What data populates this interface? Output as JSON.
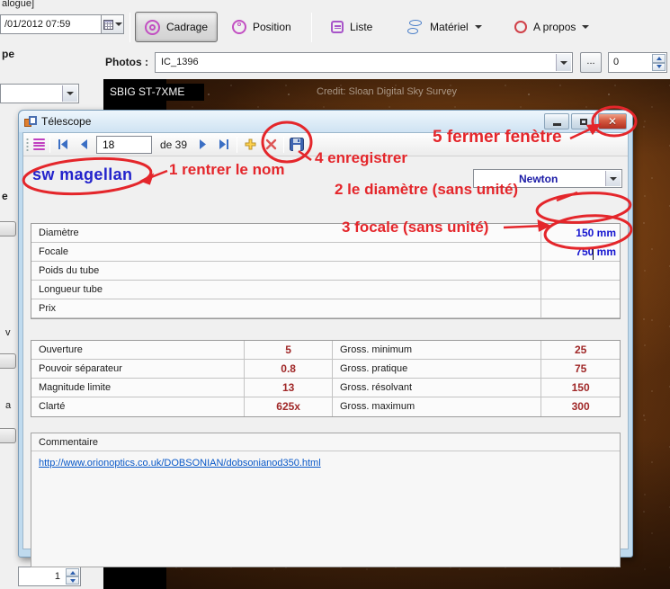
{
  "palette": {
    "annotation_red": "#e4262b",
    "value_blue": "#1515d0",
    "value_maroon": "#a02828",
    "name_blue": "#2323cc",
    "aero_frame": "#bfdaee"
  },
  "window": {
    "title_fragment": "alogue]"
  },
  "main_toolbar": {
    "date_value": "/01/2012 07:59",
    "buttons": {
      "cadrage": "Cadrage",
      "position": "Position",
      "liste": "Liste",
      "materiel": "Matériel",
      "apropos": "A propos"
    }
  },
  "photos_bar": {
    "label": "Photos :",
    "selected_photo": "IC_1396",
    "more_button": "...",
    "counter_value": "0"
  },
  "photo_viewer": {
    "camera_label": "SBIG ST-7XME",
    "credit": "Credit: Sloan Digital Sky Survey"
  },
  "sidebar": {
    "fragment_pe": "pe",
    "fragment_e": "e",
    "fragment_v": "v",
    "fragment_a": "a",
    "spinner_value": "1"
  },
  "dialog": {
    "title": "Télescope",
    "nav": {
      "record": "18",
      "of_label": "de 39"
    },
    "name_value": "sw magellan",
    "type_value": "Newton",
    "table1": {
      "rows": [
        {
          "label": "Diamètre",
          "value": "150 mm"
        },
        {
          "label": "Focale",
          "value": "750 mm"
        },
        {
          "label": "Poids du tube",
          "value": ""
        },
        {
          "label": "Longueur tube",
          "value": ""
        },
        {
          "label": "Prix",
          "value": ""
        }
      ]
    },
    "table2": {
      "rows": [
        {
          "label1": "Ouverture",
          "value1": "5",
          "label2": "Gross. minimum",
          "value2": "25"
        },
        {
          "label1": "Pouvoir séparateur",
          "value1": "0.8",
          "label2": "Gross. pratique",
          "value2": "75"
        },
        {
          "label1": "Magnitude limite",
          "value1": "13",
          "label2": "Gross. résolvant",
          "value2": "150"
        },
        {
          "label1": "Clarté",
          "value1": "625x",
          "label2": "Gross. maximum",
          "value2": "300"
        }
      ]
    },
    "comment": {
      "label": "Commentaire",
      "link": "http://www.orionoptics.co.uk/DOBSONIAN/dobsonianod350.html"
    }
  },
  "annotations": {
    "step1": "1 rentrer le nom",
    "step2": "2 le diamètre (sans unité)",
    "step3": "3 focale (sans unité)",
    "step4": "4 enregistrer",
    "step5": "5 fermer fenètre"
  }
}
